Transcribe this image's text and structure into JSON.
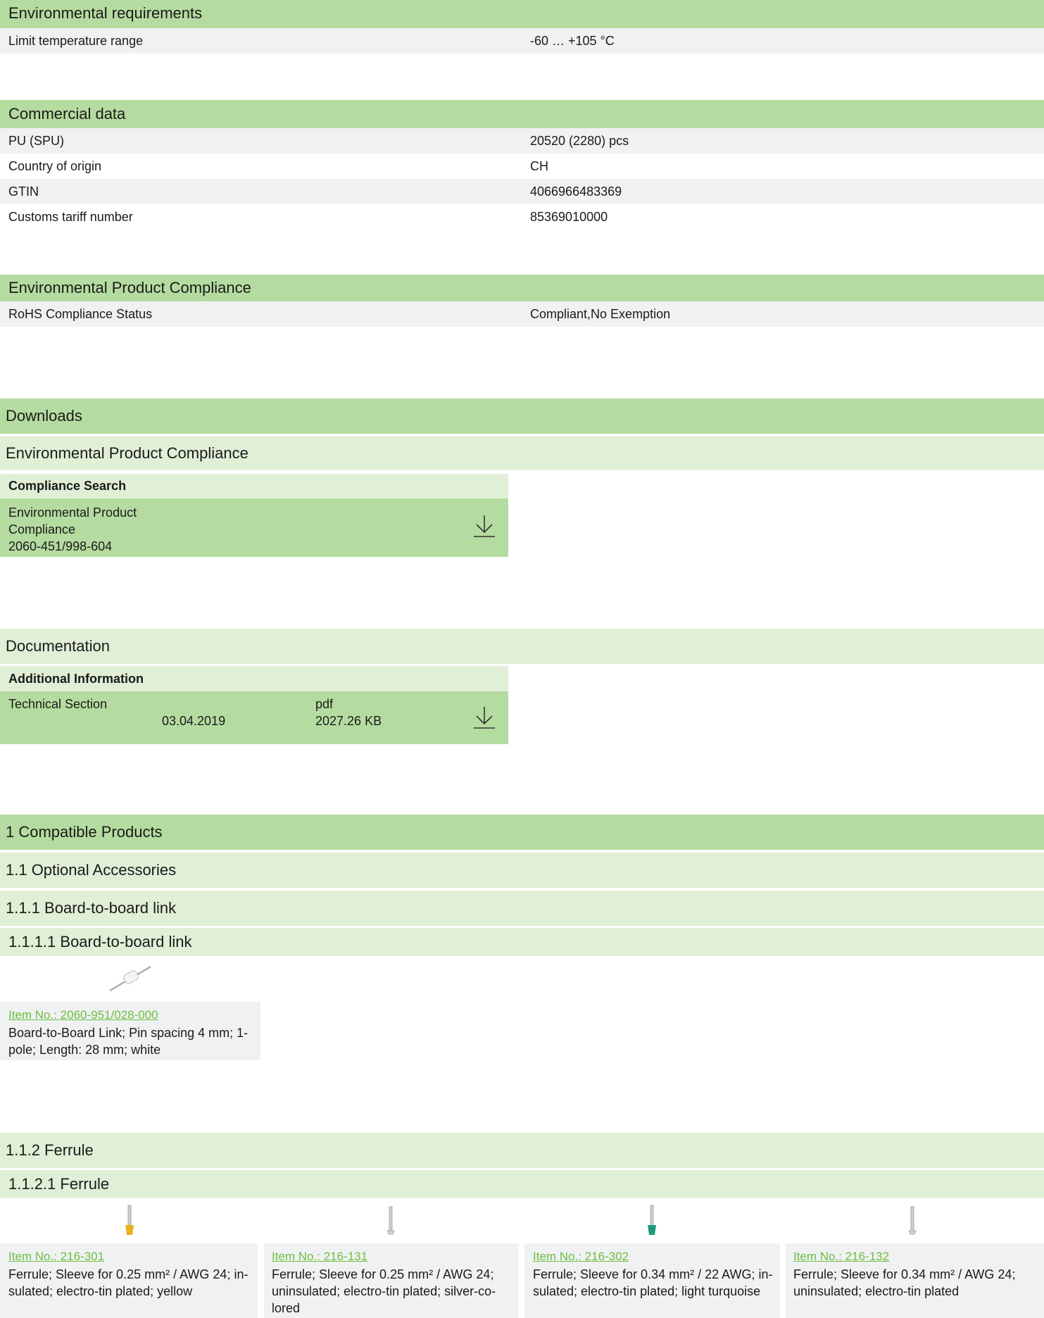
{
  "environmental": {
    "title": "Environmental requirements",
    "rows": [
      {
        "key": "Limit temperature range",
        "value": "-60 … +105 °C"
      }
    ]
  },
  "commercial": {
    "title": "Commercial data",
    "rows": [
      {
        "key": "PU (SPU)",
        "value": "20520 (2280) pcs"
      },
      {
        "key": "Country of origin",
        "value": "CH"
      },
      {
        "key": "GTIN",
        "value": "4066966483369"
      },
      {
        "key": "Customs tariff number",
        "value": "85369010000"
      }
    ]
  },
  "compliance": {
    "title": "Environmental Product Compliance",
    "rows": [
      {
        "key": "RoHS Compliance Status",
        "value": "Compliant,No Exemption"
      }
    ]
  },
  "downloads": {
    "title": "Downloads",
    "epc_title": "Environmental Product Compliance",
    "search_title": "Compliance Search",
    "epc_line1": "Environmental Product",
    "epc_line2": "Compliance",
    "epc_line3": "2060-451/998-604",
    "doc_title": "Documentation",
    "addinfo_title": "Additional Information",
    "tech_name": "Technical Section",
    "tech_date": "03.04.2019",
    "tech_type": "pdf",
    "tech_size": "2027.26 KB"
  },
  "compatible": {
    "title": "1 Compatible Products",
    "optional": "1.1 Optional Accessories",
    "btb": "1.1.1 Board-to-board link",
    "btb_sub": "1.1.1.1 Board-to-board link",
    "btb_item": {
      "link": "Item No.: 2060-951/028-000",
      "line1": "Board-to-Board Link; Pin spacing 4 mm; 1-",
      "line2": "pole; Length: 28 mm; white"
    },
    "ferrule": "1.1.2 Ferrule",
    "ferrule_sub": "1.1.2.1 Ferrule",
    "ferrules": [
      {
        "link": "Item No.: 216-301",
        "line1": "Ferrule; Sleeve for 0.25 mm² / AWG 24; in-",
        "line2": "sulated; electro-tin plated; yellow",
        "line3": "",
        "color": "#e8b21f"
      },
      {
        "link": "Item No.: 216-131",
        "line1": "Ferrule; Sleeve for 0.25 mm² / AWG 24;",
        "line2": "uninsulated; electro-tin plated; silver-co-",
        "line3": "lored",
        "color": "#c8c8c8"
      },
      {
        "link": "Item No.: 216-302",
        "line1": "Ferrule; Sleeve for 0.34 mm² / 22 AWG; in-",
        "line2": "sulated; electro-tin plated; light turquoise",
        "line3": "",
        "color": "#1f9a7a"
      },
      {
        "link": "Item No.: 216-132",
        "line1": "Ferrule; Sleeve for 0.34 mm² / AWG 24;",
        "line2": "uninsulated; electro-tin plated",
        "line3": "",
        "color": "#c8c8c8"
      }
    ]
  }
}
